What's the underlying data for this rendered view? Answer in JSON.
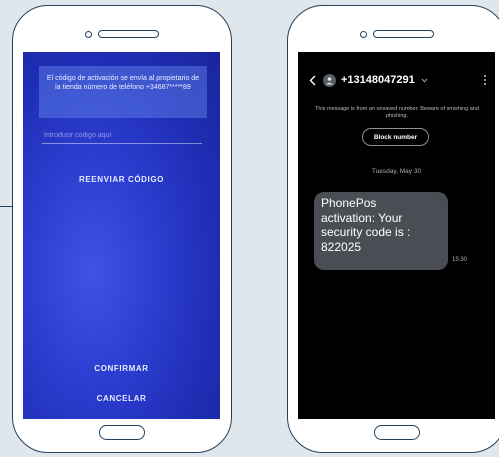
{
  "activation_screen": {
    "info_message": "El código de activación se envía al propietario de la tienda número de teléfono +34687*****89",
    "code_input_placeholder": "Introducir código aquí",
    "code_input_value": "",
    "resend_label": "REENVIAR CÓDIGO",
    "confirm_label": "CONFIRMAR",
    "cancel_label": "CANCELAR",
    "colors": {
      "background": "#2b3ed0",
      "info_box": "#6b8cf0"
    }
  },
  "sms_screen": {
    "sender": "+13148047291",
    "unsaved_notice": "This message is from an unsaved number. Beware of smishing and phishing.",
    "block_label": "Block number",
    "date": "Tuesday, May 30",
    "message": "PhonePos\nactivation: Your\nsecurity code is :\n822025",
    "time": "15:30",
    "icons": {
      "back": "back-arrow-icon",
      "avatar": "person-avatar-icon",
      "expand": "chevron-down-icon",
      "menu": "more-vertical-icon"
    },
    "colors": {
      "background": "#000000",
      "bubble": "#4a4e54"
    }
  },
  "frame_colors": {
    "page_background": "#dfe6ec",
    "phone_outline": "#24415c"
  }
}
